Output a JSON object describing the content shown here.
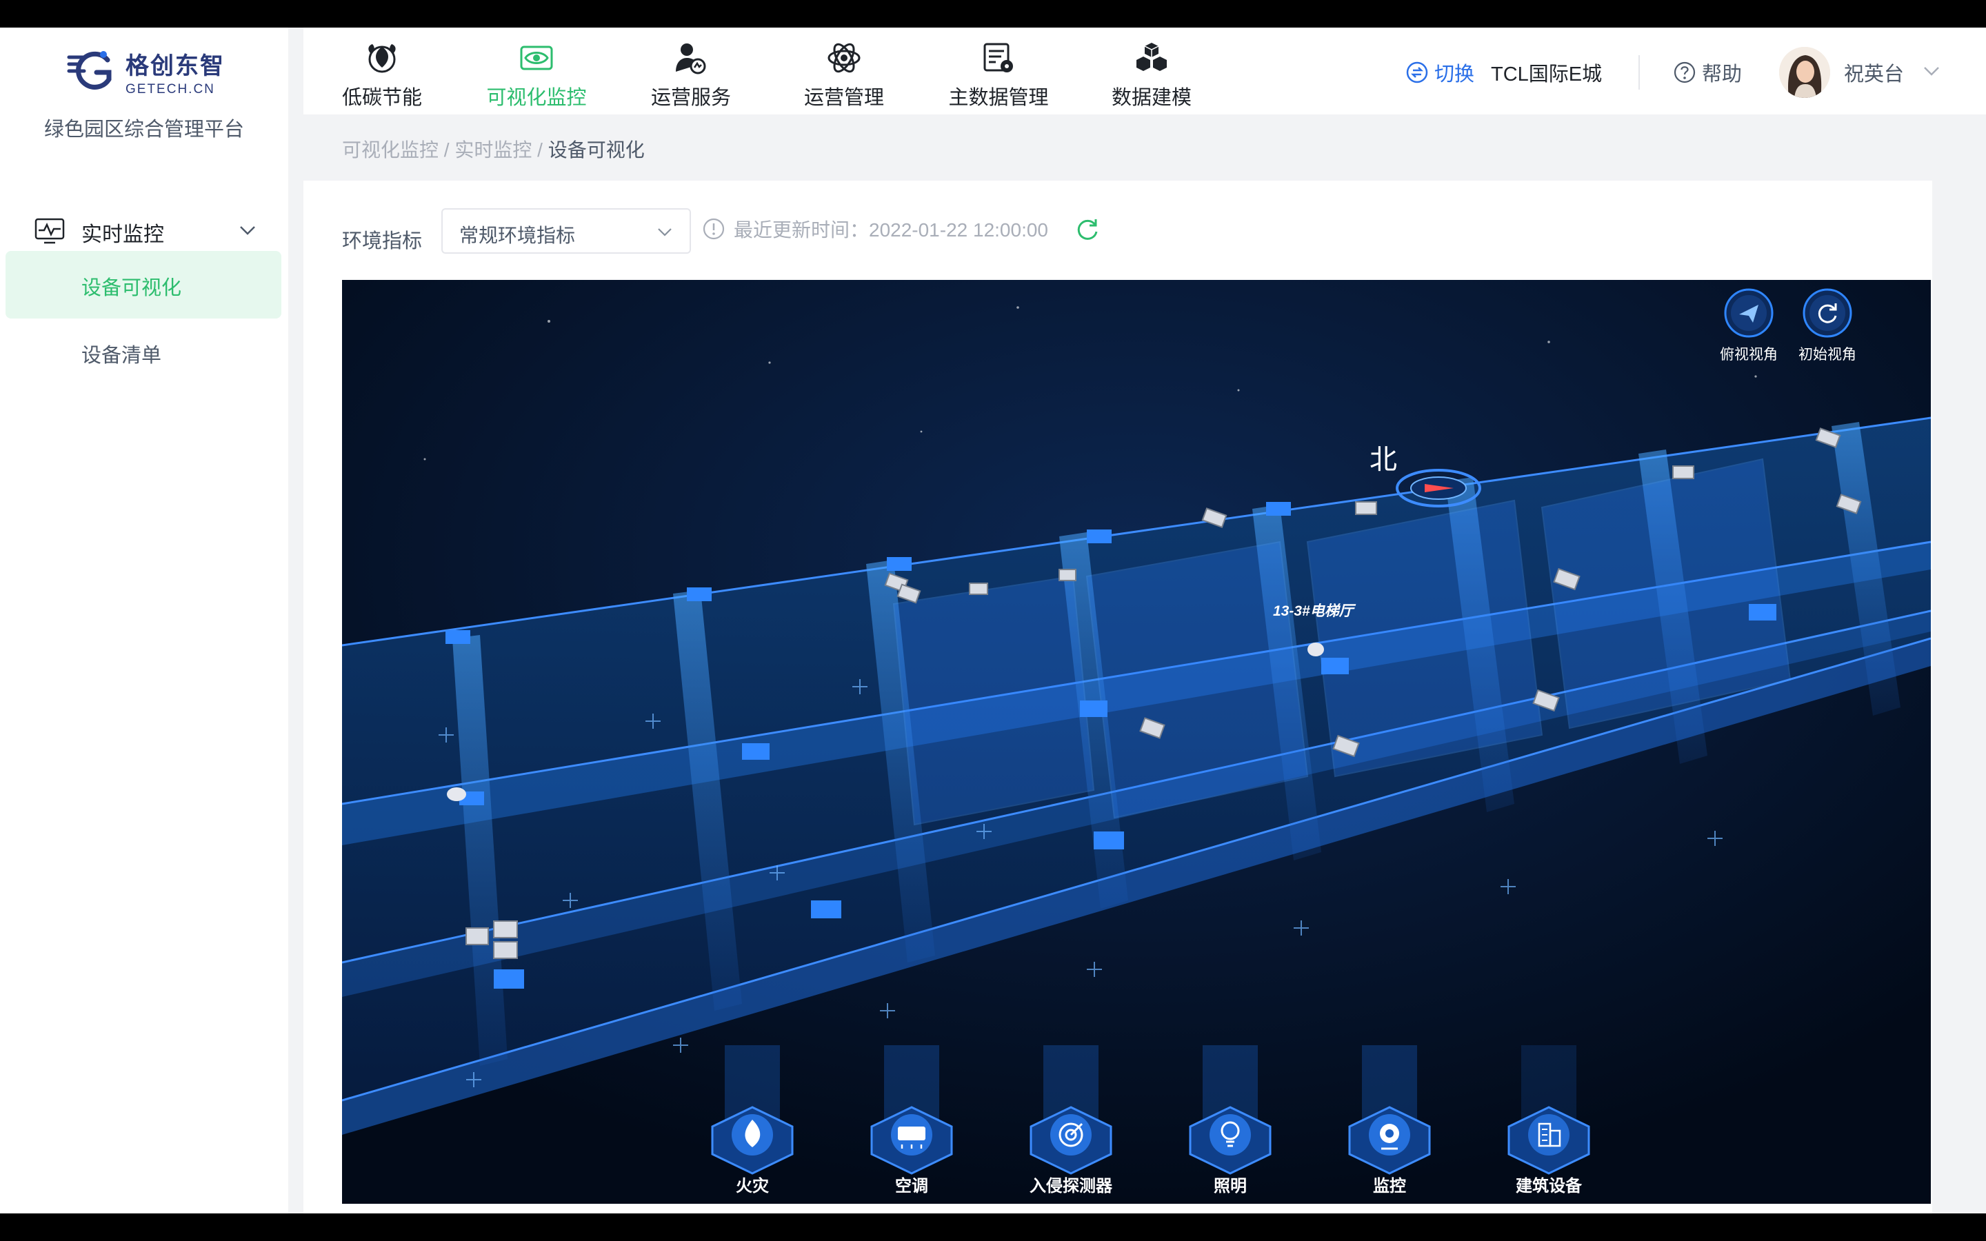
{
  "app": {
    "logo_cn": "格创东智",
    "logo_en": "GETECH.CN",
    "platform_name": "绿色园区综合管理平台"
  },
  "sidebar": {
    "group_label": "实时监控",
    "items": [
      {
        "label": "设备可视化",
        "active": true
      },
      {
        "label": "设备清单",
        "active": false
      }
    ]
  },
  "header": {
    "nav": [
      {
        "label": "低碳节能",
        "icon": "leaf-icon",
        "active": false
      },
      {
        "label": "可视化监控",
        "icon": "eye-icon",
        "active": true
      },
      {
        "label": "运营服务",
        "icon": "service-user-icon",
        "active": false
      },
      {
        "label": "运营管理",
        "icon": "atom-icon",
        "active": false
      },
      {
        "label": "主数据管理",
        "icon": "data-settings-icon",
        "active": false
      },
      {
        "label": "数据建模",
        "icon": "cubes-icon",
        "active": false
      }
    ],
    "switch_label": "切换",
    "park_name": "TCL国际E城",
    "help_label": "帮助",
    "user_name": "祝英台"
  },
  "breadcrumb": {
    "items": [
      "可视化监控",
      "实时监控",
      "设备可视化"
    ],
    "separator": "/"
  },
  "filter": {
    "label": "环境指标",
    "selected": "常规环境指标",
    "update_text": "最近更新时间：2022-01-22 12:00:00"
  },
  "viewport": {
    "top_view_label": "俯视视角",
    "initial_view_label": "初始视角",
    "north_label": "北",
    "elevator_label": "13-3#电梯厅",
    "categories": [
      {
        "label": "火灾",
        "icon": "fire-icon"
      },
      {
        "label": "空调",
        "icon": "air-conditioner-icon"
      },
      {
        "label": "入侵探测器",
        "icon": "radar-icon"
      },
      {
        "label": "照明",
        "icon": "bulb-icon"
      },
      {
        "label": "监控",
        "icon": "camera-icon"
      },
      {
        "label": "建筑设备",
        "icon": "building-icon"
      }
    ]
  },
  "colors": {
    "accent_green": "#2dbd6e",
    "link_blue": "#2a6fe8",
    "brand_navy": "#2a3a7a",
    "scene_blue": "#2f86ff"
  }
}
